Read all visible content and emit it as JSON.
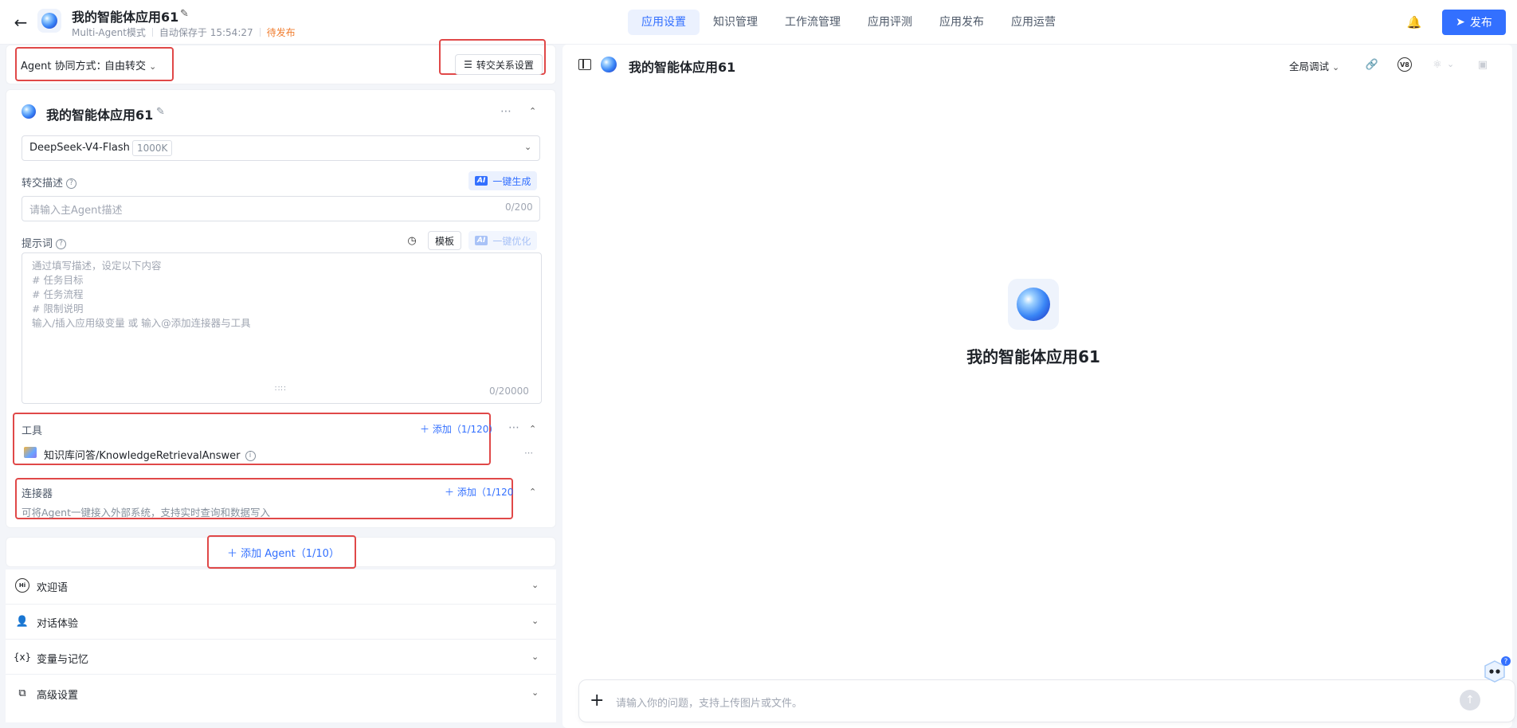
{
  "header": {
    "back_icon": "arrow-left-icon",
    "app_title": "我的智能体应用61",
    "mode": "Multi-Agent模式",
    "autosave": "自动保存于 15:54:27",
    "status": "待发布",
    "tabs": [
      {
        "label": "应用设置",
        "active": true
      },
      {
        "label": "知识管理",
        "active": false
      },
      {
        "label": "工作流管理",
        "active": false
      },
      {
        "label": "应用评测",
        "active": false
      },
      {
        "label": "应用发布",
        "active": false
      },
      {
        "label": "应用运营",
        "active": false
      }
    ],
    "publish_label": "发布",
    "accent_color": "#3370ff",
    "status_color": "#f07d2f"
  },
  "collab": {
    "label": "Agent 协同方式：",
    "value": "自由转交",
    "transfer_btn": "转交关系设置"
  },
  "agent": {
    "name": "我的智能体应用61",
    "model": "DeepSeek-V4-Flash",
    "context": "1000K",
    "handoff_label": "转交描述",
    "gen_btn": "一键生成",
    "handoff_placeholder": "请输入主Agent描述",
    "handoff_count": "0/200",
    "prompt_label": "提示词",
    "template_btn": "模板",
    "optimize_btn": "一键优化",
    "prompt_placeholder": "通过填写描述，设定以下内容\n# 任务目标\n# 任务流程\n# 限制说明\n输入/插入应用级变量 或 输入@添加连接器与工具",
    "prompt_count": "0/20000",
    "tools_label": "工具",
    "tools_add": "添加（1/120）",
    "tool_item": "知识库问答/KnowledgeRetrievalAnswer",
    "connector_label": "连接器",
    "connector_add": "添加（1/120",
    "connector_desc": "可将Agent一键接入外部系统，支持实时查询和数据写入",
    "ai_tag": "AI"
  },
  "add_agent": "添加 Agent（1/10）",
  "accordions": [
    {
      "icon": "greeting-icon",
      "label": "欢迎语"
    },
    {
      "icon": "user-chat-icon",
      "label": "对话体验"
    },
    {
      "icon": "variable-icon",
      "label": "变量与记忆"
    },
    {
      "icon": "settings-copy-icon",
      "label": "高级设置"
    }
  ],
  "right": {
    "title": "我的智能体应用61",
    "debug_mode": "全局调试",
    "center_title": "我的智能体应用61",
    "chat_placeholder": "请输入你的问题，支持上传图片或文件。",
    "v_badge": "V8"
  }
}
